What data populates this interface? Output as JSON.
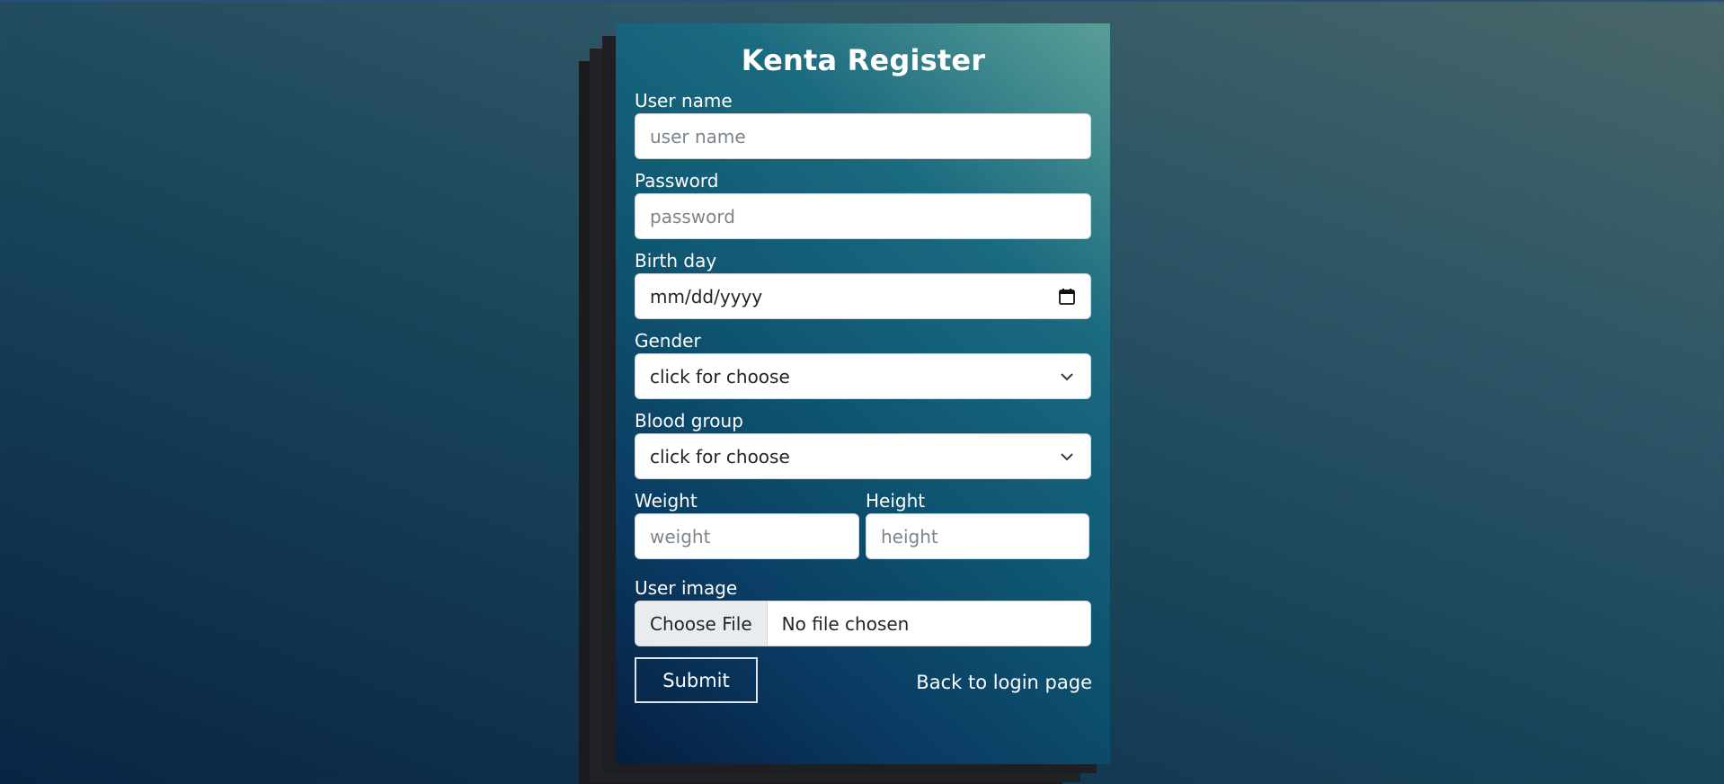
{
  "form": {
    "title": "Kenta Register",
    "username": {
      "label": "User name",
      "placeholder": "user name"
    },
    "password": {
      "label": "Password",
      "placeholder": "password"
    },
    "birthday": {
      "label": "Birth day",
      "value": "mm/dd/yyyy"
    },
    "gender": {
      "label": "Gender",
      "selected": "click for choose"
    },
    "blood_group": {
      "label": "Blood group",
      "selected": "click for choose"
    },
    "weight": {
      "label": "Weight",
      "placeholder": "weight"
    },
    "height": {
      "label": "Height",
      "placeholder": "height"
    },
    "user_image": {
      "label": "User image",
      "button": "Choose File",
      "status": "No file chosen"
    },
    "submit_label": "Submit",
    "back_link": "Back to login page"
  },
  "colors": {
    "card_top": "#5a9e96",
    "card_bottom": "#061e40",
    "page_bg": "#174257"
  },
  "icons": [
    "calendar-icon",
    "chevron-down-icon"
  ]
}
